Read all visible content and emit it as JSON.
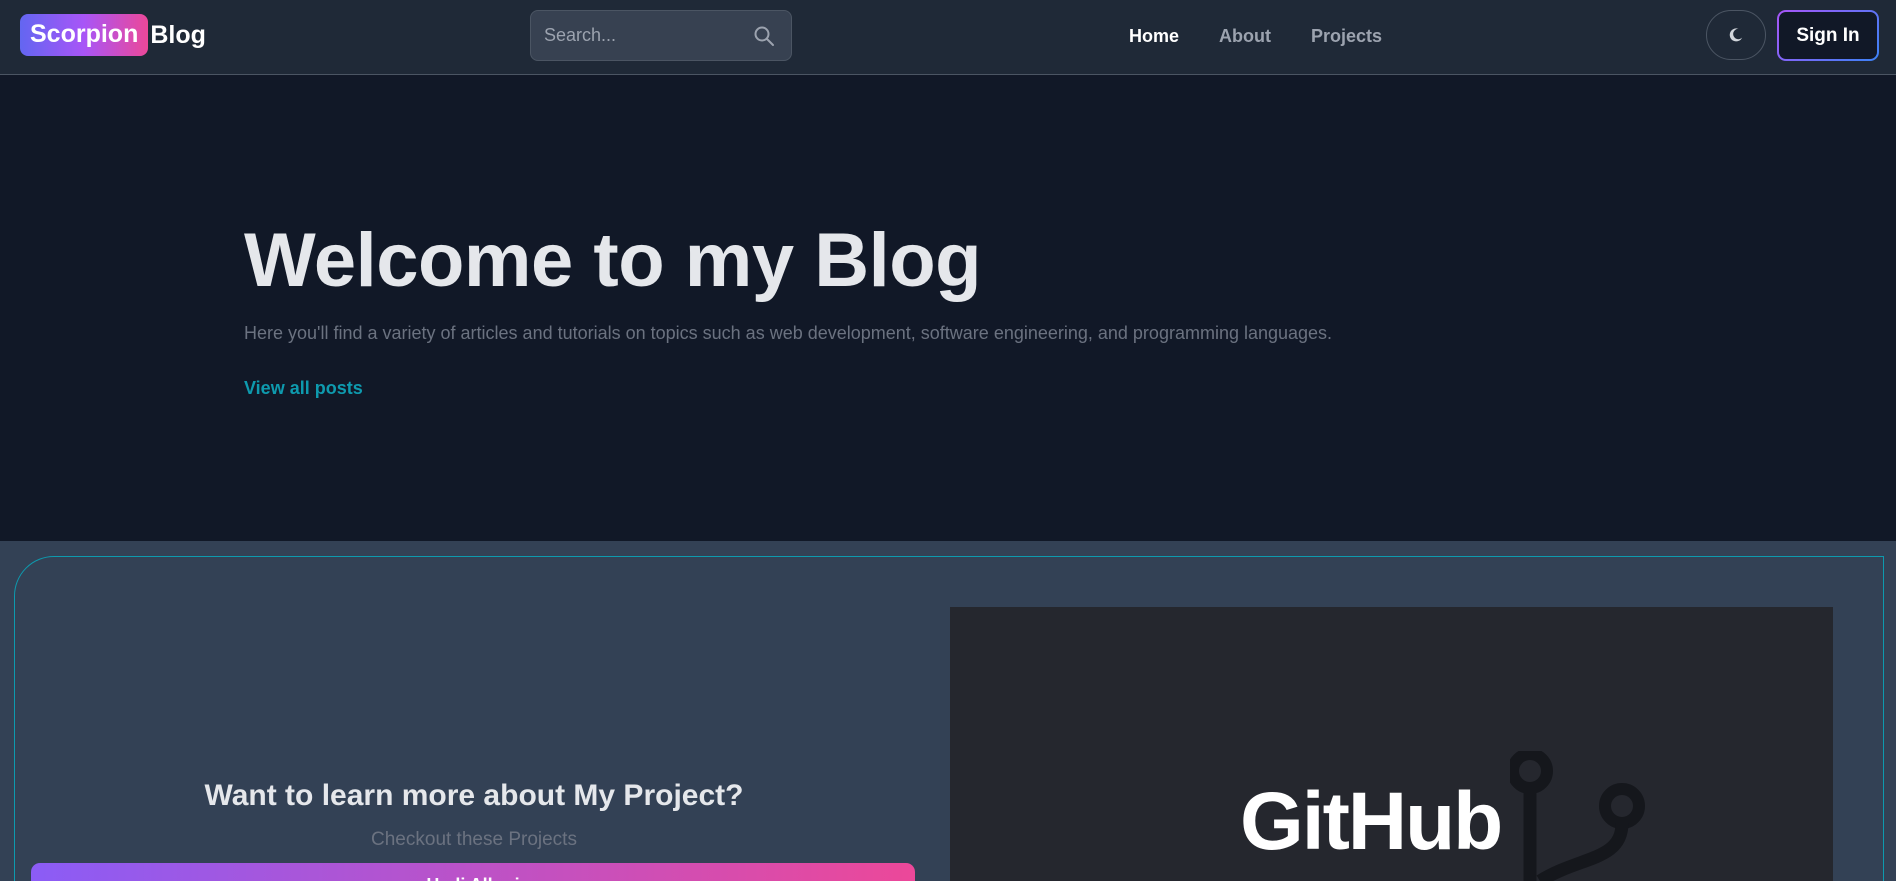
{
  "header": {
    "logo_badge": "Scorpion",
    "logo_text": "Blog",
    "search_placeholder": "Search...",
    "nav": [
      {
        "label": "Home",
        "active": true
      },
      {
        "label": "About",
        "active": false
      },
      {
        "label": "Projects",
        "active": false
      }
    ],
    "theme_icon": "moon-icon",
    "signin_label": "Sign In"
  },
  "hero": {
    "title": "Welcome to my Blog",
    "subtitle": "Here you'll find a variety of articles and tutorials on topics such as web development, software engineering, and programming languages.",
    "link_label": "View all posts"
  },
  "project_cta": {
    "heading": "Want to learn more about My Project?",
    "subheading": "Checkout these Projects",
    "button_label": "Hadi Alkari",
    "image_word": "GitHub"
  },
  "colors": {
    "background": "#111827",
    "navbar": "#1f2937",
    "section": "#334155",
    "accent_link": "#0e9aae",
    "gradient_start": "#8b5cf6",
    "gradient_end": "#ec4899"
  }
}
